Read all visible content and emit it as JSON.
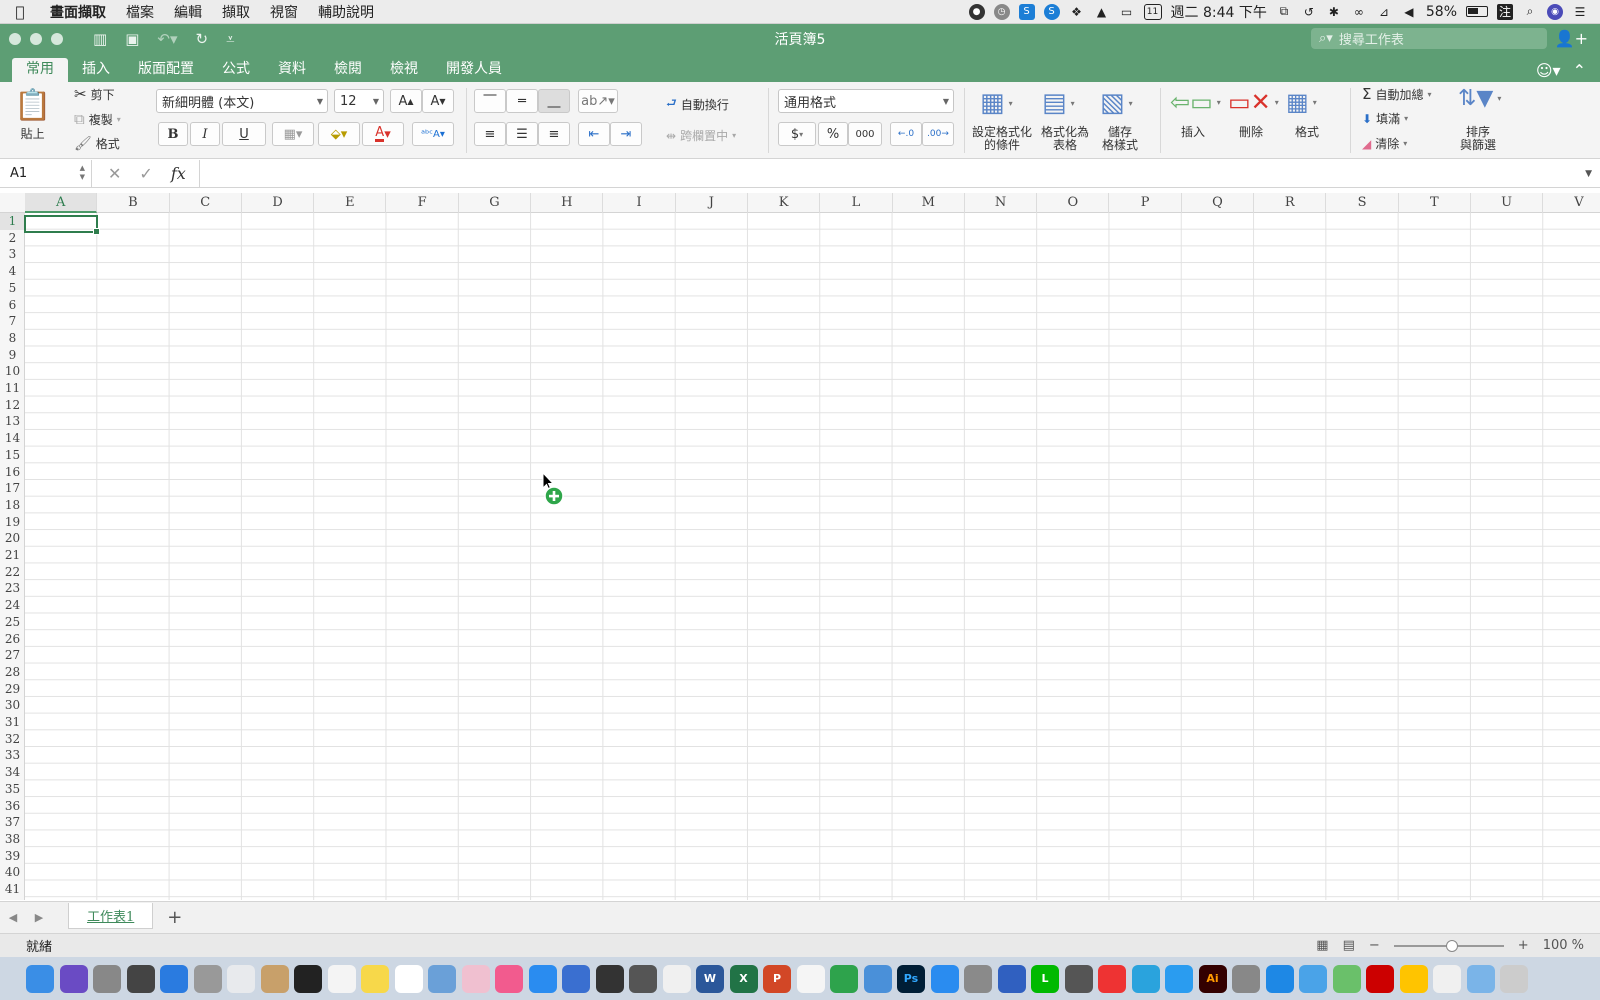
{
  "menubar": {
    "app_name": "畫面擷取",
    "items": [
      "檔案",
      "編輯",
      "擷取",
      "視窗",
      "輔助說明"
    ],
    "status": {
      "date_badge": "11",
      "datetime": "週二 8:44 下午",
      "battery": "58%",
      "input_method": "注"
    }
  },
  "window": {
    "title": "活頁簿5",
    "search_placeholder": "搜尋工作表"
  },
  "ribbon_tabs": [
    "常用",
    "插入",
    "版面配置",
    "公式",
    "資料",
    "檢閱",
    "檢視",
    "開發人員"
  ],
  "ribbon": {
    "paste": "貼上",
    "cut": "剪下",
    "copy": "複製",
    "format_painter": "格式",
    "font_name": "新細明體 (本文)",
    "font_size": "12",
    "bold": "B",
    "italic": "I",
    "underline": "U",
    "font_color_glyph": "A",
    "wrap_text": "自動換行",
    "merge_center": "跨欄置中",
    "number_format": "通用格式",
    "currency": "$",
    "percent": "%",
    "comma": "000",
    "conditional_format": "設定格式化\n的條件",
    "format_as_table": "格式化為\n表格",
    "cell_styles": "儲存\n格樣式",
    "insert": "插入",
    "delete": "刪除",
    "format": "格式",
    "autosum": "自動加總",
    "fill": "填滿",
    "clear": "清除",
    "sort_filter": "排序\n與篩選"
  },
  "formula_bar": {
    "name_box": "A1",
    "fx": "fx",
    "value": ""
  },
  "grid": {
    "columns": [
      "A",
      "B",
      "C",
      "D",
      "E",
      "F",
      "G",
      "H",
      "I",
      "J",
      "K",
      "L",
      "M",
      "N",
      "O",
      "P",
      "Q",
      "R",
      "S",
      "T",
      "U",
      "V"
    ],
    "rows": 41,
    "selected_cell": "A1"
  },
  "sheets": {
    "tabs": [
      "工作表1"
    ],
    "add": "+"
  },
  "status_bar": {
    "status": "就緒",
    "zoom": "100 %"
  },
  "dock_apps": [
    "Finder",
    "Siri",
    "Launchpad",
    "Activity",
    "Safari",
    "Calculator",
    "Chrome",
    "Contacts",
    "Clock",
    "Reminders",
    "Notes",
    "Calendar",
    "Preview",
    "Photos",
    "Music",
    "Baidu",
    "iTunes",
    "Headphones",
    "Final Cut",
    "Pages",
    "W",
    "X",
    "P",
    "Notes2",
    "Numbers",
    "Keynote",
    "Ps",
    "App Store",
    "Settings",
    "Terminal",
    "LINE",
    "Camera",
    "Markup",
    "Telegram",
    "Airmail",
    "Ai",
    "Monitor",
    "Edge",
    "Files",
    "Maps",
    "Acrobat",
    "Network",
    "TextEdit",
    "Folder",
    "Trash"
  ]
}
